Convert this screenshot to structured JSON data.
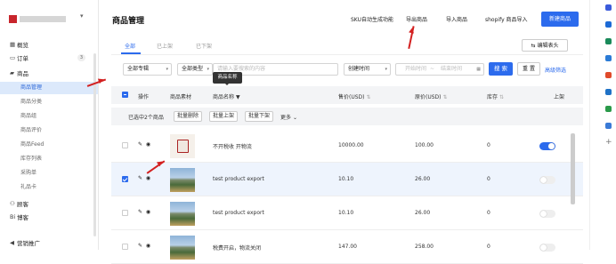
{
  "sidebar": {
    "items": [
      {
        "label": "概览",
        "icon": "grid-icon"
      },
      {
        "label": "订单",
        "icon": "order-icon",
        "badge": "3"
      },
      {
        "label": "商品",
        "icon": "goods-icon"
      },
      {
        "label": "博客",
        "icon": "blog-icon"
      },
      {
        "label": "顾客",
        "icon": "person-icon"
      },
      {
        "label": "营销推广",
        "icon": "megaphone-icon"
      }
    ],
    "sub_items": [
      "商品管理",
      "商品分类",
      "商品组",
      "商品评价",
      "商品Feed",
      "库存列表",
      "采购单",
      "礼品卡"
    ]
  },
  "header": {
    "title": "商品管理",
    "links": [
      "SKU自动生成功能",
      "导出商品",
      "导入商品",
      "shopify 商品导入"
    ],
    "new_button": "新建商品"
  },
  "tabs": [
    "全部",
    "已上架",
    "已下架"
  ],
  "edit_columns": "编辑表头",
  "filters": {
    "topic": "全部专辑",
    "type": "全部类型",
    "search_placeholder": "请输入要搜索的内容",
    "time": "创建时间",
    "start_placeholder": "开始时间",
    "separator": "~",
    "end_placeholder": "结束时间",
    "search_button": "搜 索",
    "reset_button": "重 置",
    "advanced": "高级筛选"
  },
  "tooltip": "商品名称",
  "table": {
    "headers": [
      "操作",
      "商品素材",
      "商品名称",
      "售价(USD)",
      "原价(USD)",
      "库存",
      "上架"
    ],
    "bulk": {
      "selected": "已选中2个商品",
      "buttons": [
        "批量删除",
        "批量上架",
        "批量下架"
      ],
      "more": "更多"
    },
    "rows": [
      {
        "name": "不开税收 开物流",
        "price": "10000.00",
        "orig": "100.00",
        "stock": "0",
        "on": true,
        "checked": false
      },
      {
        "name": "test product export",
        "price": "10.10",
        "orig": "26.00",
        "stock": "0",
        "on": false,
        "checked": true
      },
      {
        "name": "test product export",
        "price": "10.10",
        "orig": "26.00",
        "stock": "0",
        "on": false,
        "checked": false
      },
      {
        "name": "税费开启，物流关闭",
        "price": "147.00",
        "orig": "258.00",
        "stock": "0",
        "on": false,
        "checked": false
      }
    ]
  },
  "colors": {
    "accent": "#2c6bed",
    "arrow": "#d32020",
    "active_bg": "#dce9fb"
  }
}
